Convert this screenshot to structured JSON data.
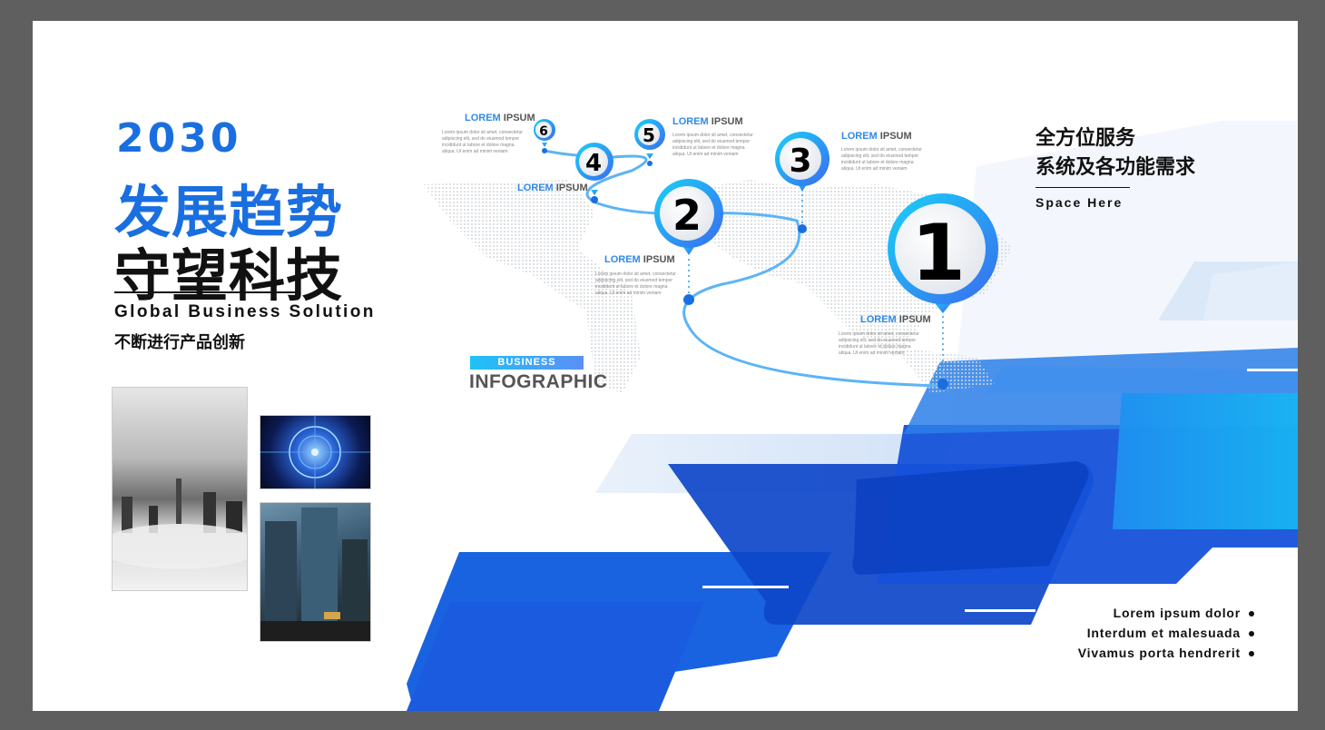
{
  "hero": {
    "year": "2030",
    "title_line1": "发展趋势",
    "title_line2": "守望科技",
    "subtitle_en": "Global Business Solution",
    "subtitle_cn": "不断进行产品创新"
  },
  "infographic": {
    "badge": "BUSINESS",
    "title": "INFOGRAPHIC",
    "steps": [
      {
        "number": "1",
        "label_blue": "LOREM",
        "label_gray": "IPSUM"
      },
      {
        "number": "2",
        "label_blue": "LOREM",
        "label_gray": "IPSUM"
      },
      {
        "number": "3",
        "label_blue": "LOREM",
        "label_gray": "IPSUM"
      },
      {
        "number": "4",
        "label_blue": "LOREM",
        "label_gray": "IPSUM"
      },
      {
        "number": "5",
        "label_blue": "LOREM",
        "label_gray": "IPSUM"
      },
      {
        "number": "6",
        "label_blue": "LOREM",
        "label_gray": "IPSUM"
      }
    ],
    "fine_text": "Lorem ipsum dolor sit amet, consectetur adipiscing elit, sed do eiusmod tempor incididunt ut labore et dolore magna aliqua. Ut enim ad minim veniam"
  },
  "right_panel": {
    "heading_line1": "全方位服务",
    "heading_line2": "系统及各功能需求",
    "space_label": "Space Here"
  },
  "bullets": [
    "Lorem ipsum dolor",
    "Interdum et malesuada",
    "Vivamus porta hendrerit"
  ],
  "colors": {
    "primary_blue": "#1a6fe0",
    "cyan": "#1ec2f7",
    "dark_blue": "#0b3fbf"
  }
}
